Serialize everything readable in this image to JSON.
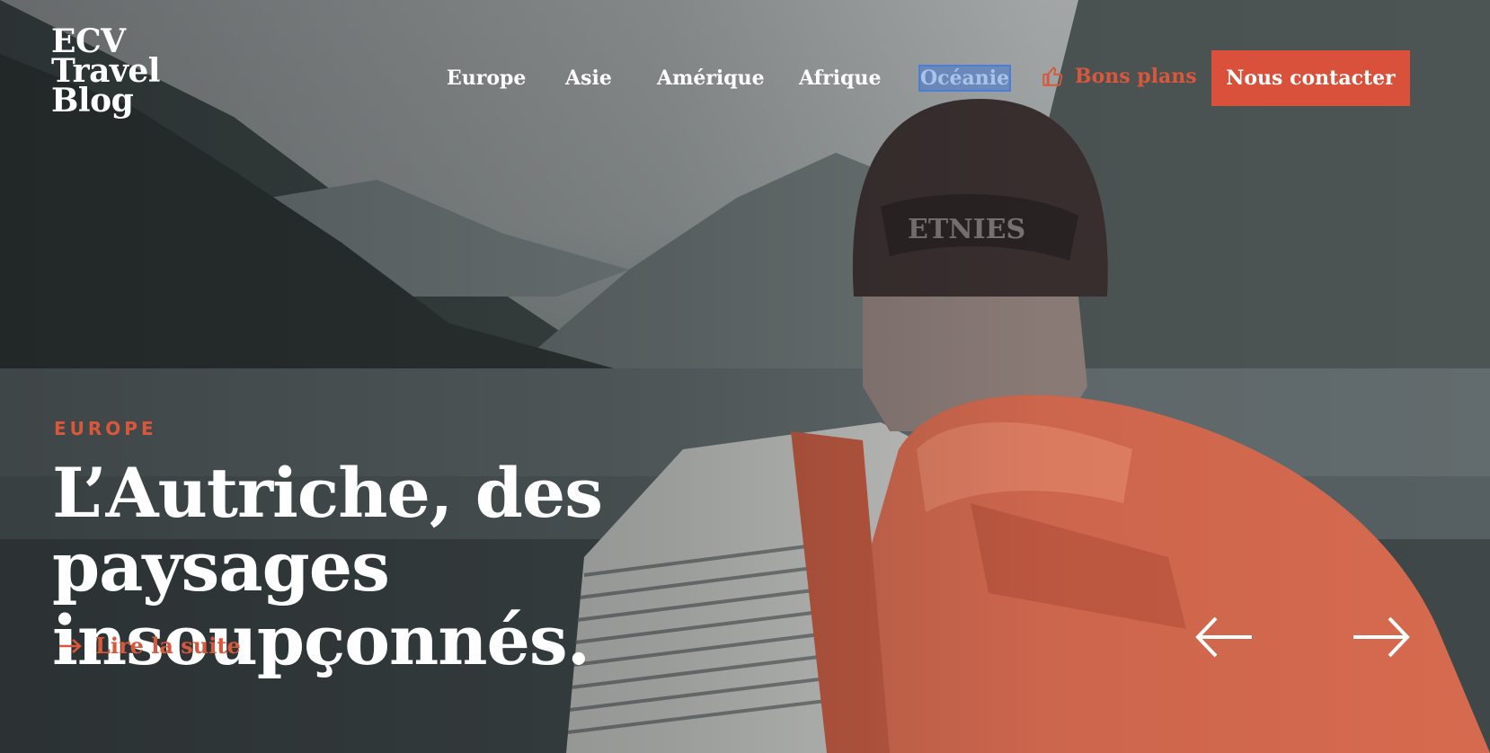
{
  "brand": {
    "line1": "ECV",
    "line2": "Travel",
    "line3": "Blog"
  },
  "nav": {
    "items": [
      {
        "label": "Europe"
      },
      {
        "label": "Asie"
      },
      {
        "label": "Amérique"
      },
      {
        "label": "Afrique"
      },
      {
        "label": "Océanie"
      }
    ],
    "selected_index": 4,
    "deals_label": "Bons plans",
    "deals_icon": "thumbs-up-icon",
    "contact_label": "Nous contacter"
  },
  "hero": {
    "category": "EUROPE",
    "title": "L’Autriche, des paysages insoupçonnés.",
    "read_more_label": "Lire la suite",
    "read_more_icon": "arrow-right-icon",
    "prev_icon": "arrow-left-icon",
    "next_icon": "arrow-right-icon"
  },
  "colors": {
    "accent": "#d9583b",
    "button": "#d9513a",
    "text": "#ffffff"
  }
}
